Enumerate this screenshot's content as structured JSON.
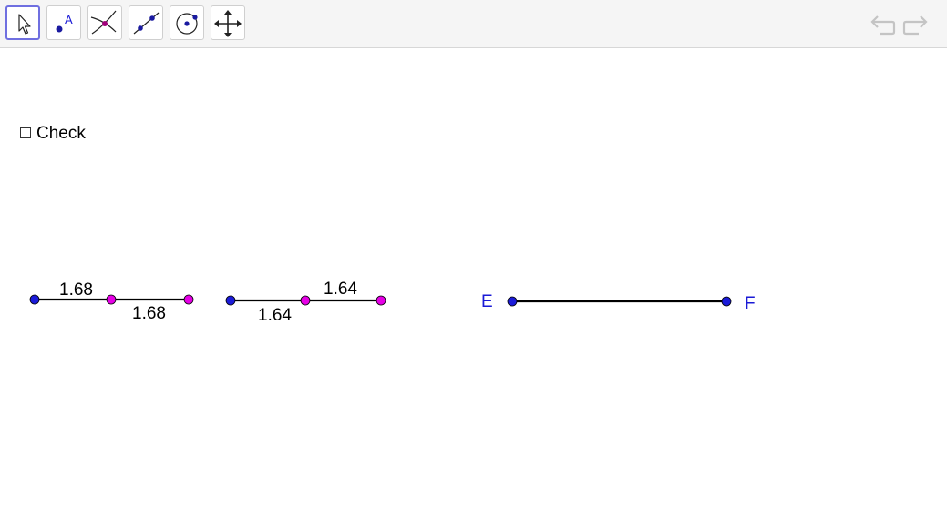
{
  "toolbar": {
    "tools": [
      {
        "icon": "move-arrow-icon",
        "active": true
      },
      {
        "icon": "point-icon",
        "label": "A"
      },
      {
        "icon": "intersect-icon"
      },
      {
        "icon": "line-icon"
      },
      {
        "icon": "circle-icon"
      },
      {
        "icon": "move-view-icon"
      }
    ],
    "undo_icon": "undo-icon",
    "redo_icon": "redo-icon"
  },
  "checkbox": {
    "label": "Check",
    "checked": false
  },
  "segments": [
    {
      "left_label": "1.68",
      "right_label": "1.68"
    },
    {
      "left_label": "1.64",
      "right_label": "1.64"
    }
  ],
  "segment_ef": {
    "start_label": "E",
    "end_label": "F"
  },
  "colors": {
    "blue_point": "#1b1bd9",
    "magenta_point": "#e600e6",
    "label_blue": "#1a1ad6"
  }
}
